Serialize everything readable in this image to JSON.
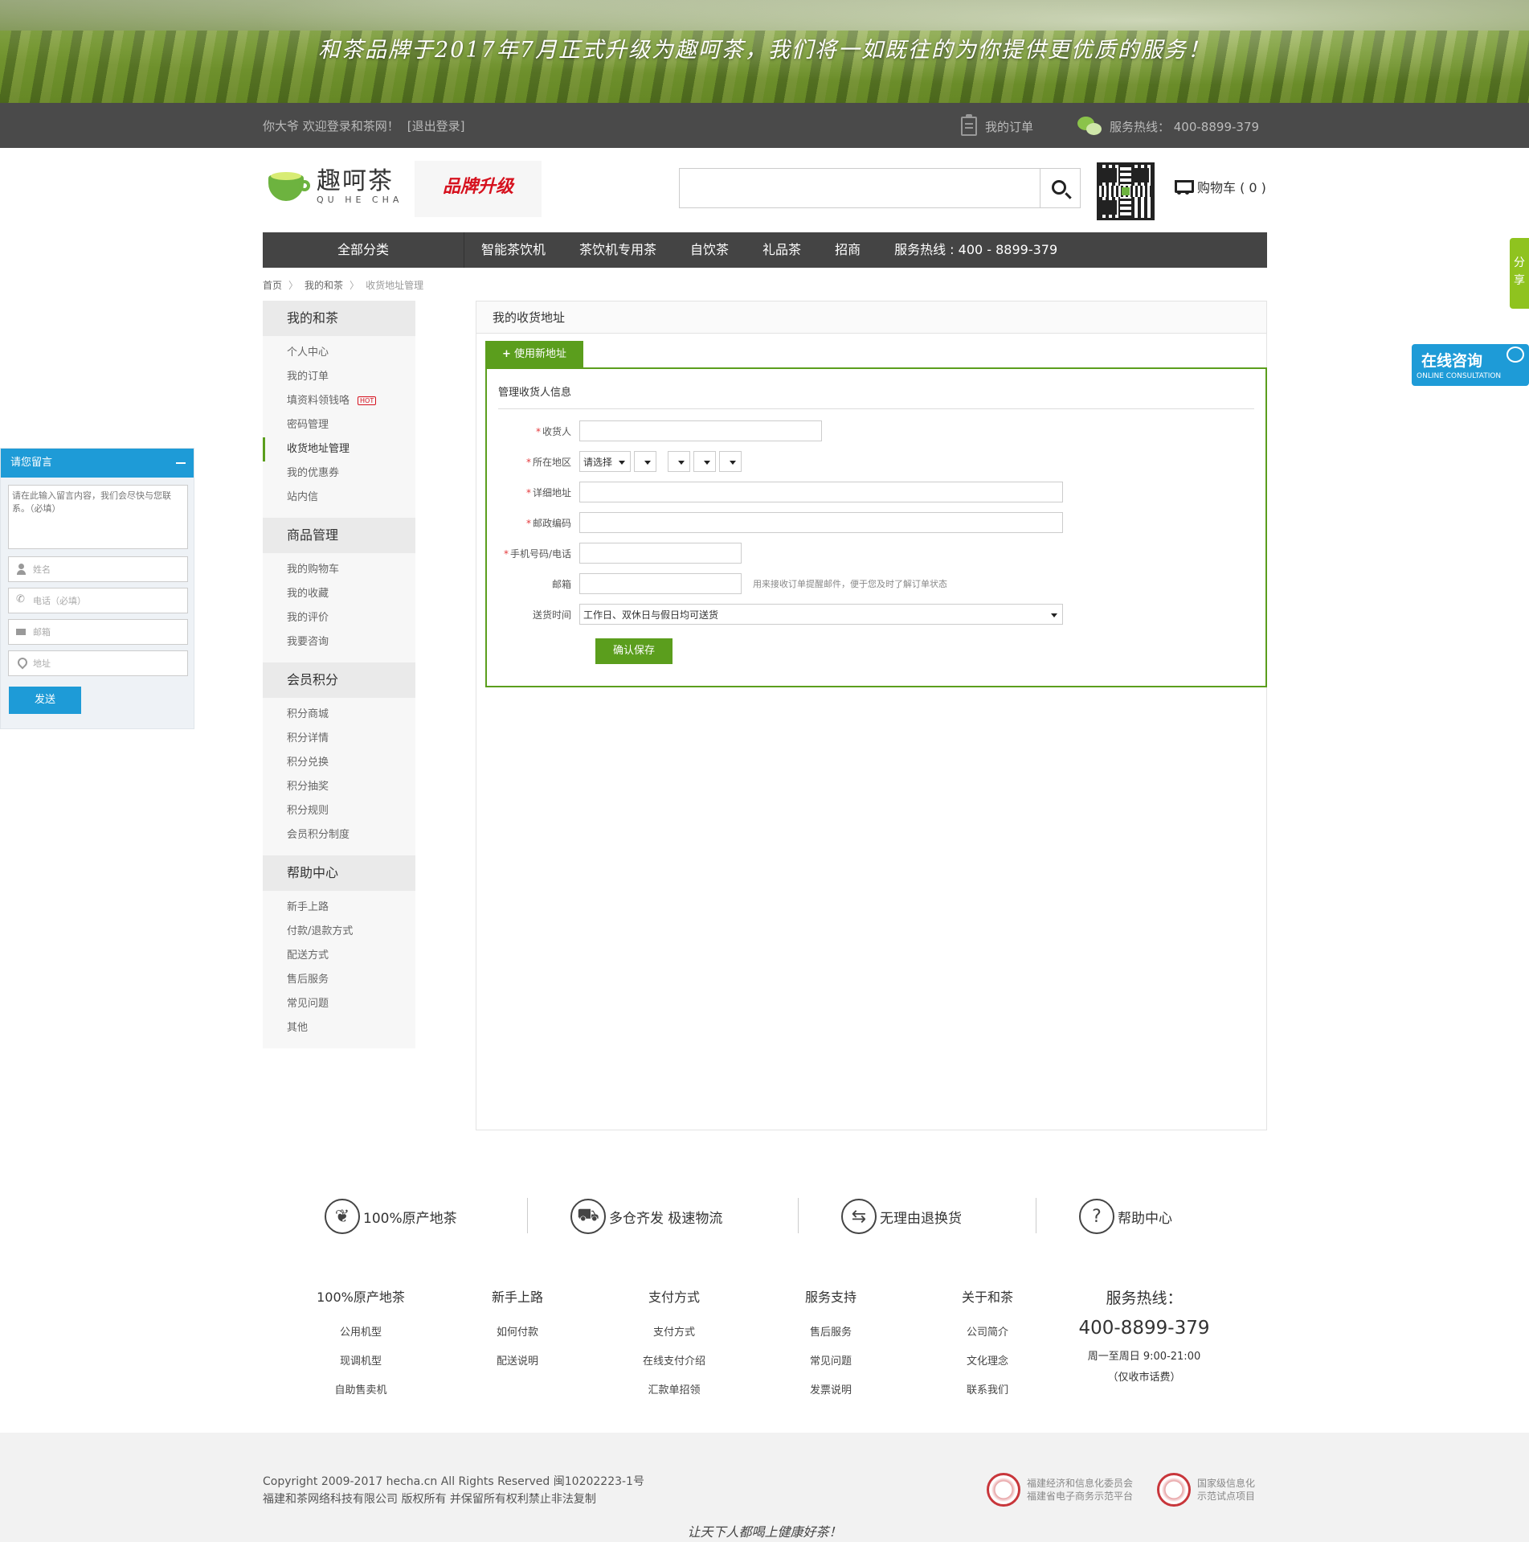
{
  "banner": {
    "slogan": "和茶品牌于2017年7月正式升级为趣呵茶，我们将一如既往的为你提供更优质的服务！"
  },
  "topbar": {
    "welcome": "你大爷 欢迎登录和茶网！",
    "logout": "[退出登录]",
    "my_orders": "我的订单",
    "hotline": "服务热线： 400-8899-379"
  },
  "header": {
    "logo_cn": "趣呵茶",
    "logo_en": "QU HE CHA",
    "upgrade": "品牌升级",
    "search_placeholder": "",
    "cart": "购物车 ( 0 )"
  },
  "nav": {
    "all": "全部分类",
    "items": [
      "智能茶饮机",
      "茶饮机专用茶",
      "自饮茶",
      "礼品茶",
      "招商",
      "服务热线 : 400 - 8899-379"
    ]
  },
  "breadcrumb": [
    "首页",
    "我的和茶",
    "收货地址管理"
  ],
  "sidebar": {
    "groups": [
      {
        "title": "我的和茶",
        "items": [
          "个人中心",
          "我的订单",
          "填资料领钱咯",
          "密码管理",
          "收货地址管理",
          "我的优惠券",
          "站内信"
        ],
        "hot_badge": "HOT"
      },
      {
        "title": "商品管理",
        "items": [
          "我的购物车",
          "我的收藏",
          "我的评价",
          "我要咨询"
        ]
      },
      {
        "title": "会员积分",
        "items": [
          "积分商城",
          "积分详情",
          "积分兑换",
          "积分抽奖",
          "积分规则",
          "会员积分制度"
        ]
      },
      {
        "title": "帮助中心",
        "items": [
          "新手上路",
          "付款/退款方式",
          "配送方式",
          "售后服务",
          "常见问题",
          "其他"
        ]
      }
    ]
  },
  "main": {
    "title": "我的收货地址",
    "new_address": "使用新地址",
    "section": "管理收货人信息",
    "form": {
      "receiver": "收货人",
      "region": "所在地区",
      "region_select": "请选择",
      "address": "详细地址",
      "postcode": "邮政编码",
      "phone": "手机号码/电话",
      "email": "邮箱",
      "email_hint": "用来接收订单提醒邮件，便于您及时了解订单状态",
      "delivery_time": "送货时间",
      "delivery_value": "工作日、双休日与假日均可送货",
      "save": "确认保存"
    }
  },
  "message": {
    "title": "请您留言",
    "content_placeholder": "请在此输入留言内容，我们会尽快与您联系。（必填）",
    "name": "姓名",
    "phone": "电话（必填）",
    "email": "邮箱",
    "address": "地址",
    "send": "发送"
  },
  "floating": {
    "share": "分享",
    "online_cn": "在线咨询",
    "online_en": "ONLINE CONSULTATION"
  },
  "services": [
    "100%原产地茶",
    "多仓齐发 极速物流",
    "无理由退换货",
    "帮助中心"
  ],
  "footer_cols": [
    {
      "title": "100%原产地茶",
      "links": [
        "公用机型",
        "现调机型",
        "自助售卖机"
      ]
    },
    {
      "title": "新手上路",
      "links": [
        "如何付款",
        "配送说明"
      ]
    },
    {
      "title": "支付方式",
      "links": [
        "支付方式",
        "在线支付介绍",
        "汇款单招领"
      ]
    },
    {
      "title": "服务支持",
      "links": [
        "售后服务",
        "常见问题",
        "发票说明"
      ]
    },
    {
      "title": "关于和茶",
      "links": [
        "公司简介",
        "文化理念",
        "联系我们"
      ]
    }
  ],
  "hotline_block": {
    "title": "服务热线：",
    "number": "400-8899-379",
    "hours": "周一至周日 9:00-21:00",
    "note": "（仅收市话费）"
  },
  "bottom": {
    "copyright": "Copyright 2009-2017 hecha.cn All Rights Reserved 闽10202223-1号",
    "company": "福建和茶网络科技有限公司 版权所有 并保留所有权利禁止非法复制",
    "cert1_line1": "福建经济和信息化委员会",
    "cert1_line2": "福建省电子商务示范平台",
    "cert2_line1": "国家级信息化",
    "cert2_line2": "示范试点项目",
    "motto": "让天下人都喝上健康好茶！"
  },
  "colors": {
    "brand_green": "#5b9e1d",
    "accent_blue": "#1e9bd7",
    "nav_dark": "#444444",
    "upgrade_red": "#d6111e"
  }
}
